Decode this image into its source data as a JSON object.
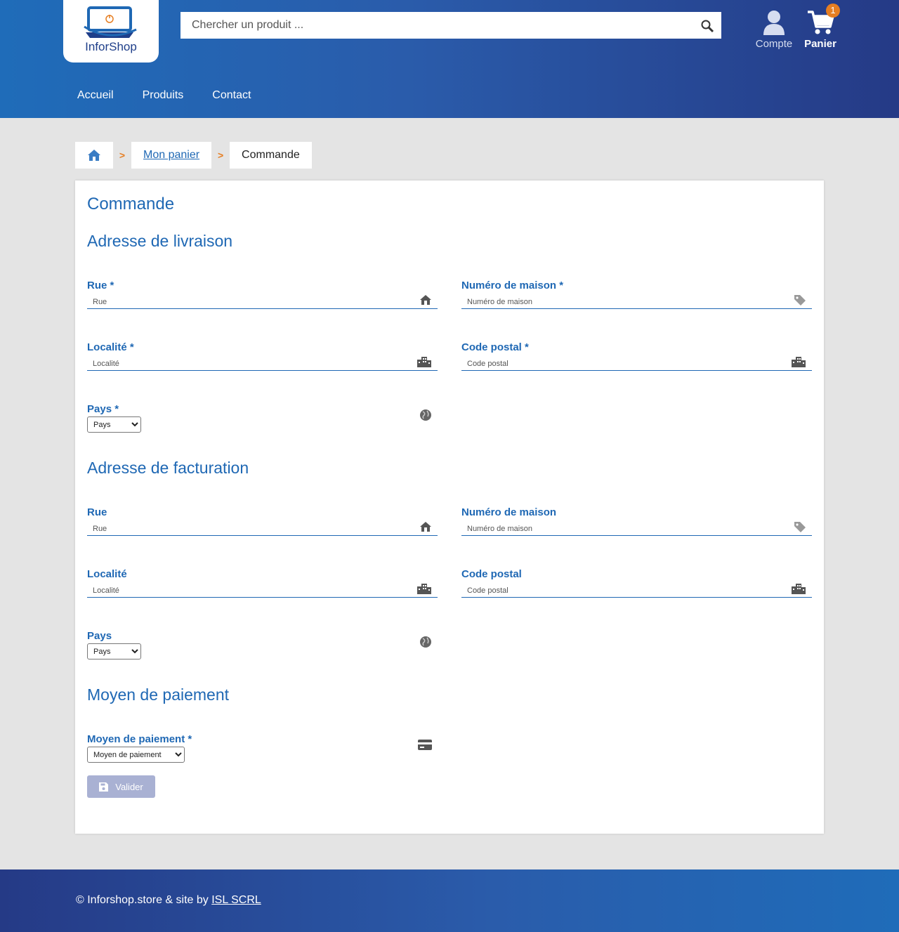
{
  "header": {
    "logo_text": "InforShop",
    "search_placeholder": "Chercher un produit ...",
    "account_label": "Compte",
    "cart_label": "Panier",
    "cart_count": "1",
    "nav": [
      "Accueil",
      "Produits",
      "Contact"
    ]
  },
  "breadcrumb": {
    "home_icon": "home-icon",
    "separator": ">",
    "cart_link": "Mon panier",
    "current": "Commande"
  },
  "form": {
    "title": "Commande",
    "delivery": {
      "heading": "Adresse de livraison",
      "street_label": "Rue *",
      "street_placeholder": "Rue",
      "house_label": "Numéro de maison *",
      "house_placeholder": "Numéro de maison",
      "city_label": "Localité *",
      "city_placeholder": "Localité",
      "zip_label": "Code postal *",
      "zip_placeholder": "Code postal",
      "country_label": "Pays *",
      "country_value": "Pays"
    },
    "billing": {
      "heading": "Adresse de facturation",
      "street_label": "Rue",
      "street_placeholder": "Rue",
      "house_label": "Numéro de maison",
      "house_placeholder": "Numéro de maison",
      "city_label": "Localité",
      "city_placeholder": "Localité",
      "zip_label": "Code postal",
      "zip_placeholder": "Code postal",
      "country_label": "Pays",
      "country_value": "Pays"
    },
    "payment": {
      "heading": "Moyen de paiement",
      "label": "Moyen de paiement *",
      "value": "Moyen de paiement"
    },
    "submit_label": "Valider"
  },
  "footer": {
    "text": "© Inforshop.store & site by ",
    "link": "ISL SCRL"
  },
  "colors": {
    "accent": "#1f68b4",
    "badge": "#e67e22",
    "button_disabled": "#a9b1d3"
  }
}
